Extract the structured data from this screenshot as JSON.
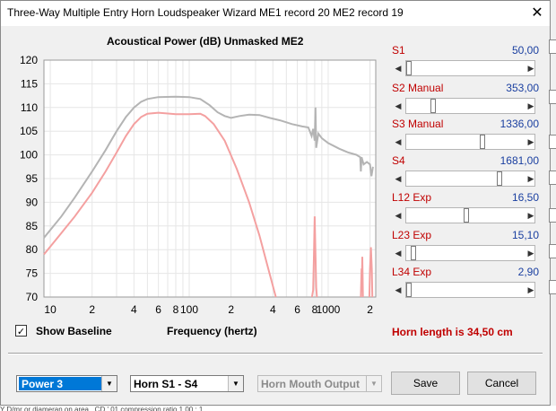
{
  "window": {
    "title": "Three-Way Multiple Entry Horn Loudspeaker Wizard   ME1 record 20   ME2 record 19",
    "close_glyph": "✕"
  },
  "chart_title": "Acoustical Power (dB)   Unmasked   ME2",
  "chart_data": {
    "type": "line",
    "title": "Acoustical Power (dB)   Unmasked   ME2",
    "xlabel": "Frequency (hertz)",
    "ylabel": "",
    "x_scale": "log",
    "xlim": [
      9,
      2200
    ],
    "ylim": [
      70,
      120
    ],
    "y_ticks": [
      "120",
      "115",
      "110",
      "105",
      "100",
      "95",
      "90",
      "85",
      "80",
      "75",
      "70"
    ],
    "x_tick_labels": [
      {
        "x": 10,
        "label": "10"
      },
      {
        "x": 20,
        "label": "2"
      },
      {
        "x": 40,
        "label": "4"
      },
      {
        "x": 60,
        "label": "6"
      },
      {
        "x": 80,
        "label": "8"
      },
      {
        "x": 100,
        "label": "100"
      },
      {
        "x": 200,
        "label": "2"
      },
      {
        "x": 400,
        "label": "4"
      },
      {
        "x": 600,
        "label": "6"
      },
      {
        "x": 800,
        "label": "8"
      },
      {
        "x": 1000,
        "label": "1000"
      },
      {
        "x": 2000,
        "label": "2"
      }
    ],
    "grid": true,
    "series": [
      {
        "color": "#b4b4b4",
        "points": [
          [
            9,
            82.5
          ],
          [
            12,
            87
          ],
          [
            15,
            91
          ],
          [
            20,
            96.5
          ],
          [
            25,
            101
          ],
          [
            30,
            105
          ],
          [
            35,
            108
          ],
          [
            40,
            110
          ],
          [
            45,
            111.2
          ],
          [
            50,
            111.8
          ],
          [
            60,
            112.2
          ],
          [
            80,
            112.3
          ],
          [
            100,
            112.2
          ],
          [
            120,
            111.8
          ],
          [
            140,
            110.5
          ],
          [
            160,
            109
          ],
          [
            180,
            108.2
          ],
          [
            200,
            107.8
          ],
          [
            230,
            108.2
          ],
          [
            270,
            108.5
          ],
          [
            320,
            108.4
          ],
          [
            380,
            107.8
          ],
          [
            450,
            107.3
          ],
          [
            550,
            106.5
          ],
          [
            650,
            106
          ],
          [
            720,
            105.8
          ],
          [
            760,
            104
          ],
          [
            780,
            105.5
          ],
          [
            800,
            103
          ],
          [
            810,
            110
          ],
          [
            820,
            101.5
          ],
          [
            850,
            104.5
          ],
          [
            900,
            103.5
          ],
          [
            1000,
            102.5
          ],
          [
            1200,
            101.3
          ],
          [
            1400,
            100.5
          ],
          [
            1600,
            100
          ],
          [
            1700,
            99.5
          ],
          [
            1720,
            96.5
          ],
          [
            1740,
            99.5
          ],
          [
            1800,
            98
          ],
          [
            1900,
            98.5
          ],
          [
            2000,
            98
          ],
          [
            2050,
            95.5
          ],
          [
            2100,
            97.5
          ]
        ]
      },
      {
        "color": "#f4a0a0",
        "points": [
          [
            9,
            79
          ],
          [
            12,
            83.5
          ],
          [
            15,
            87
          ],
          [
            20,
            92
          ],
          [
            25,
            96.5
          ],
          [
            30,
            100.5
          ],
          [
            35,
            104
          ],
          [
            40,
            106.5
          ],
          [
            45,
            108
          ],
          [
            50,
            108.7
          ],
          [
            60,
            108.9
          ],
          [
            80,
            108.6
          ],
          [
            100,
            108.6
          ],
          [
            120,
            108.7
          ],
          [
            130,
            108.2
          ],
          [
            150,
            106.5
          ],
          [
            180,
            103
          ],
          [
            220,
            97
          ],
          [
            270,
            90
          ],
          [
            320,
            83
          ],
          [
            370,
            76
          ],
          [
            420,
            70
          ]
        ]
      },
      {
        "color": "#f4a0a0",
        "points": [
          [
            765,
            70
          ],
          [
            780,
            71.5
          ],
          [
            790,
            79
          ],
          [
            800,
            87
          ],
          [
            810,
            79
          ],
          [
            820,
            72
          ],
          [
            830,
            70
          ]
        ]
      },
      {
        "color": "#f4a0a0",
        "points": [
          [
            1720,
            70
          ],
          [
            1740,
            76
          ],
          [
            1750,
            74
          ],
          [
            1760,
            78.5
          ],
          [
            1770,
            74
          ],
          [
            1780,
            70
          ]
        ]
      },
      {
        "color": "#f4a0a0",
        "points": [
          [
            1980,
            70
          ],
          [
            2000,
            76
          ],
          [
            2030,
            80.5
          ],
          [
            2060,
            76
          ],
          [
            2080,
            70
          ]
        ]
      }
    ]
  },
  "sliders": [
    {
      "label": "S1",
      "value": "50,00",
      "pos": 0.0
    },
    {
      "label": "S2  Manual",
      "value": "353,00",
      "pos": 0.2
    },
    {
      "label": "S3  Manual",
      "value": "1336,00",
      "pos": 0.6
    },
    {
      "label": "S4",
      "value": "1681,00",
      "pos": 0.74
    },
    {
      "label": "L12  Exp",
      "value": "16,50",
      "pos": 0.47
    },
    {
      "label": "L23  Exp",
      "value": "15,10",
      "pos": 0.04
    },
    {
      "label": "L34  Exp",
      "value": "2,90",
      "pos": 0.0
    }
  ],
  "controls": {
    "show_baseline_label": "Show Baseline",
    "show_baseline_checked": "✓",
    "frequency_label": "Frequency (hertz)",
    "horn_length": "Horn length is 34,50 cm",
    "combo_power": "Power 3",
    "combo_horn": "Horn S1 - S4",
    "combo_output": "Horn Mouth Output",
    "save_label": "Save",
    "cancel_label": "Cancel"
  },
  "bottom_strip_text": "Y   D/mr or diameran    on area ,    CD  ' 01 compression ratio    1.00 : 1"
}
